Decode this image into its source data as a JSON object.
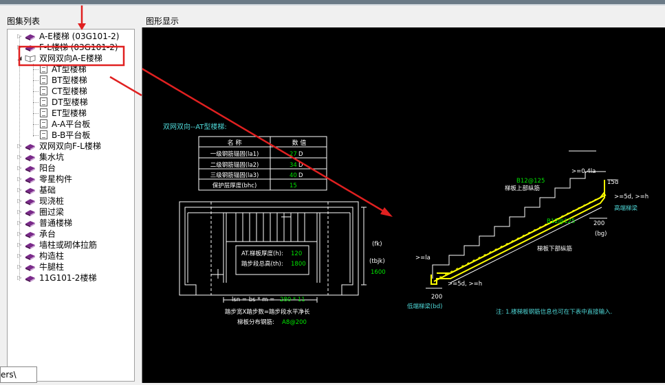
{
  "left_panel": {
    "title": "图集列表"
  },
  "right_panel": {
    "title": "图形显示"
  },
  "tree": [
    {
      "label": "A-E楼梯 (03G101-2)",
      "type": "book",
      "expanded": false
    },
    {
      "label": "F-L楼梯 (03G101-2)",
      "type": "book",
      "expanded": false
    },
    {
      "label": "双网双向A-E楼梯",
      "type": "book-open",
      "expanded": true,
      "highlighted": true
    },
    {
      "label": "AT型楼梯",
      "type": "doc",
      "child": true,
      "selected": true
    },
    {
      "label": "BT型楼梯",
      "type": "doc",
      "child": true
    },
    {
      "label": "CT型楼梯",
      "type": "doc",
      "child": true
    },
    {
      "label": "DT型楼梯",
      "type": "doc",
      "child": true
    },
    {
      "label": "ET型楼梯",
      "type": "doc",
      "child": true
    },
    {
      "label": "A-A平台板",
      "type": "doc",
      "child": true
    },
    {
      "label": "B-B平台板",
      "type": "doc",
      "child": true
    },
    {
      "label": "双网双向F-L楼梯",
      "type": "book",
      "expanded": false
    },
    {
      "label": "集水坑",
      "type": "book",
      "expanded": false
    },
    {
      "label": "阳台",
      "type": "book",
      "expanded": false
    },
    {
      "label": "零星构件",
      "type": "book",
      "expanded": false
    },
    {
      "label": "基础",
      "type": "book",
      "expanded": false
    },
    {
      "label": "现浇桩",
      "type": "book",
      "expanded": false
    },
    {
      "label": "圈过梁",
      "type": "book",
      "expanded": false
    },
    {
      "label": "普通楼梯",
      "type": "book",
      "expanded": false
    },
    {
      "label": "承台",
      "type": "book",
      "expanded": false
    },
    {
      "label": "墙柱或砌体拉筋",
      "type": "book",
      "expanded": false
    },
    {
      "label": "构造柱",
      "type": "book",
      "expanded": false
    },
    {
      "label": "牛腿柱",
      "type": "book",
      "expanded": false
    },
    {
      "label": "11G101-2楼梯",
      "type": "book",
      "expanded": false
    }
  ],
  "tooltip": {
    "text": "ers\\"
  },
  "drawing": {
    "heading": "双网双向--AT型楼梯:",
    "table": {
      "headers": [
        "名 称",
        "数 值"
      ],
      "rows": [
        {
          "name": "一级钢筋锚固(la1)",
          "value": "27",
          "unit": "D"
        },
        {
          "name": "二级钢筋锚固(la2)",
          "value": "34",
          "unit": "D"
        },
        {
          "name": "三级钢筋锚固(la3)",
          "value": "40",
          "unit": "D"
        },
        {
          "name": "保护层厚度(bhc)",
          "value": "15",
          "unit": ""
        }
      ]
    },
    "plan": {
      "thickness_label": "AT.梯板厚度(h):",
      "thickness_value": "120",
      "height_label": "踏步段总高(th):",
      "height_value": "1800",
      "fk": "(fk)",
      "tbjk": "(tbjk)",
      "tbjk_value": "1600",
      "lsn_prefix": "lsn = bs * m = ",
      "lsn_value": "280 * 11",
      "note1": "踏步宽X踏步数=踏步段水平净长",
      "note2_label": "梯板分布钢筋:",
      "note2_value": "A8@200"
    },
    "section": {
      "top_rebar": "B12@125",
      "top_rebar_label": "梯板上部纵筋",
      "bottom_rebar": "B12@125",
      "bottom_rebar_label": "梯板下部纵筋",
      "dim_041": ">=0.4la",
      "dim_15d": "15d",
      "dim_5d_h_right": ">=5d, >=h",
      "high_beam": "高端梯梁",
      "dim_200_right": "200",
      "bg": "(bg)",
      "dim_la": ">=la",
      "dim_5d_h_left": ">=5d, >=h",
      "low_beam": "低端梯梁(bd)",
      "dim_200_left": "200"
    },
    "note": "注: 1.楼梯板钢筋信息也可在下表中直接输入."
  },
  "colors": {
    "cad_white": "#ffffff",
    "cad_cyan": "#4fd8d8",
    "cad_green": "#00e600",
    "cad_yellow": "#ffff00",
    "annotation_red": "#e02020",
    "tree_selected": "#3399ff"
  }
}
